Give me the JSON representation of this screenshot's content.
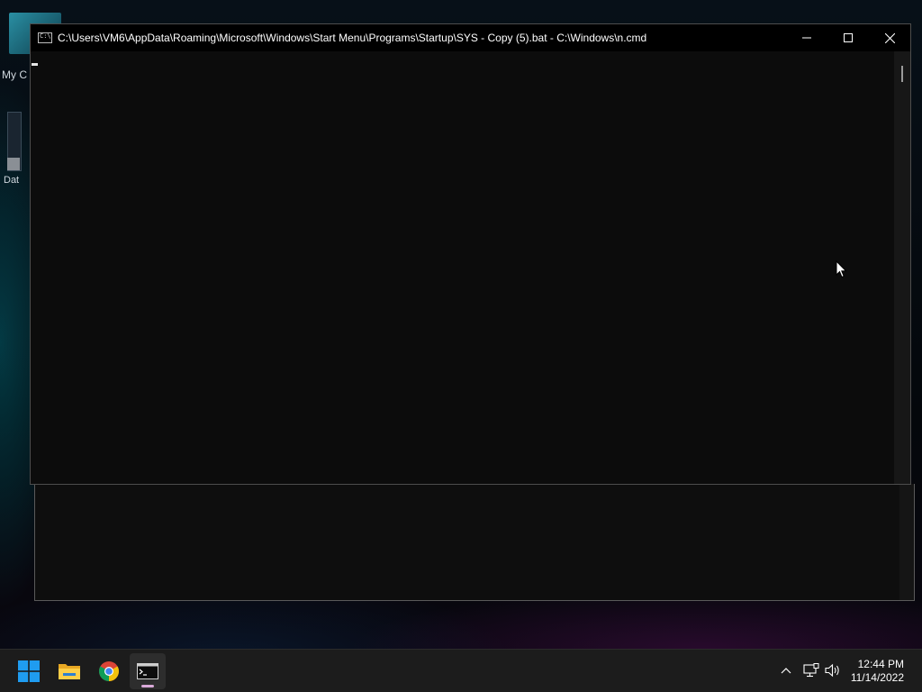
{
  "desktop": {
    "icons": [
      {
        "label": "My C"
      },
      {
        "label": "Dat"
      }
    ]
  },
  "console": {
    "title": "C:\\Users\\VM6\\AppData\\Roaming\\Microsoft\\Windows\\Start Menu\\Programs\\Startup\\SYS - Copy (5).bat - C:\\Windows\\n.cmd",
    "icon": "cmd-icon",
    "buttons": {
      "minimize": "minimize-icon",
      "maximize": "maximize-icon",
      "close": "close-icon"
    }
  },
  "taskbar": {
    "apps": [
      {
        "name": "Start",
        "icon": "windows-logo-icon"
      },
      {
        "name": "File Explorer",
        "icon": "folder-icon"
      },
      {
        "name": "Google Chrome",
        "icon": "chrome-icon"
      },
      {
        "name": "Command Prompt",
        "icon": "cmd-icon",
        "active": true
      }
    ],
    "tray": {
      "icons": [
        "chevron-up-icon",
        "network-icon",
        "volume-icon"
      ]
    },
    "clock": {
      "time": "12:44 PM",
      "date": "11/14/2022"
    }
  },
  "colors": {
    "console_bg": "#0c0c0c",
    "titlebar_bg": "#000000",
    "taskbar_bg": "#1c1c1c",
    "active_indicator": "#d9a9d8"
  }
}
